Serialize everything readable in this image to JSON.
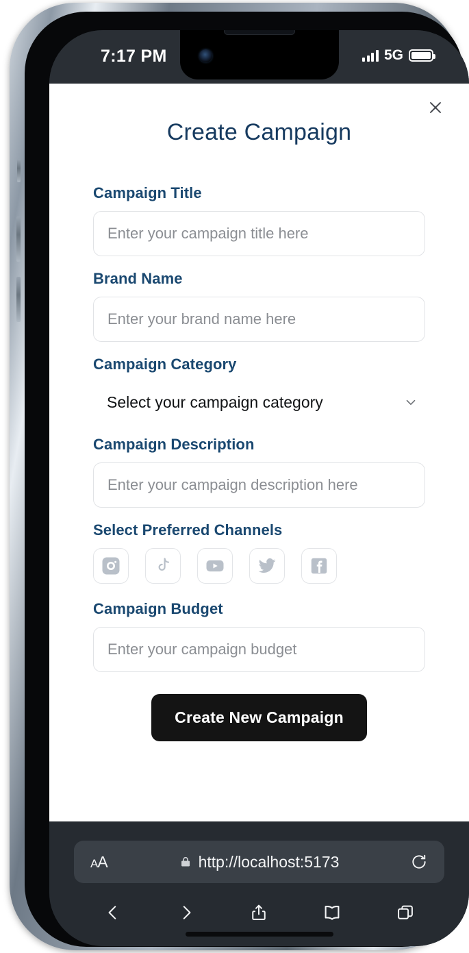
{
  "device": {
    "status_bar": {
      "time": "7:17 PM",
      "network_label": "5G",
      "signal_icon": "signal-bars-icon",
      "battery_icon": "battery-icon"
    },
    "home_indicator": "home-indicator"
  },
  "page": {
    "title": "Create Campaign",
    "close_icon": "close-icon",
    "fields": {
      "campaign_title": {
        "label": "Campaign Title",
        "placeholder": "Enter your campaign title here",
        "value": ""
      },
      "brand_name": {
        "label": "Brand Name",
        "placeholder": "Enter your brand name here",
        "value": ""
      },
      "campaign_category": {
        "label": "Campaign Category",
        "selected": "Select your campaign category",
        "chevron_icon": "chevron-down-icon"
      },
      "campaign_description": {
        "label": "Campaign Description",
        "placeholder": "Enter your campaign description here",
        "value": ""
      },
      "channels": {
        "label": "Select Preferred Channels",
        "items": [
          {
            "name": "instagram",
            "icon": "instagram-icon",
            "selected": false
          },
          {
            "name": "tiktok",
            "icon": "tiktok-icon",
            "selected": false
          },
          {
            "name": "youtube",
            "icon": "youtube-icon",
            "selected": false
          },
          {
            "name": "twitter",
            "icon": "twitter-icon",
            "selected": false
          },
          {
            "name": "facebook",
            "icon": "facebook-icon",
            "selected": false
          }
        ]
      },
      "campaign_budget": {
        "label": "Campaign Budget",
        "placeholder": "Enter your campaign budget",
        "value": ""
      }
    },
    "submit_label": "Create New Campaign"
  },
  "browser": {
    "text_size_label": "AA",
    "lock_icon": "lock-icon",
    "url": "http://localhost:5173",
    "reload_icon": "reload-icon",
    "toolbar": [
      {
        "name": "back",
        "icon": "back-chevron-icon"
      },
      {
        "name": "forward",
        "icon": "forward-chevron-icon"
      },
      {
        "name": "share",
        "icon": "share-icon"
      },
      {
        "name": "bookmarks",
        "icon": "book-icon"
      },
      {
        "name": "tabs",
        "icon": "tabs-icon"
      }
    ]
  },
  "colors": {
    "label_navy": "#1a4870",
    "title_navy": "#163a5f",
    "button_black": "#141414",
    "chrome_dark": "#262b31",
    "status_dark": "#2a2f35",
    "icon_gray": "#b9c0c9",
    "border_gray": "#e1e3e6"
  }
}
